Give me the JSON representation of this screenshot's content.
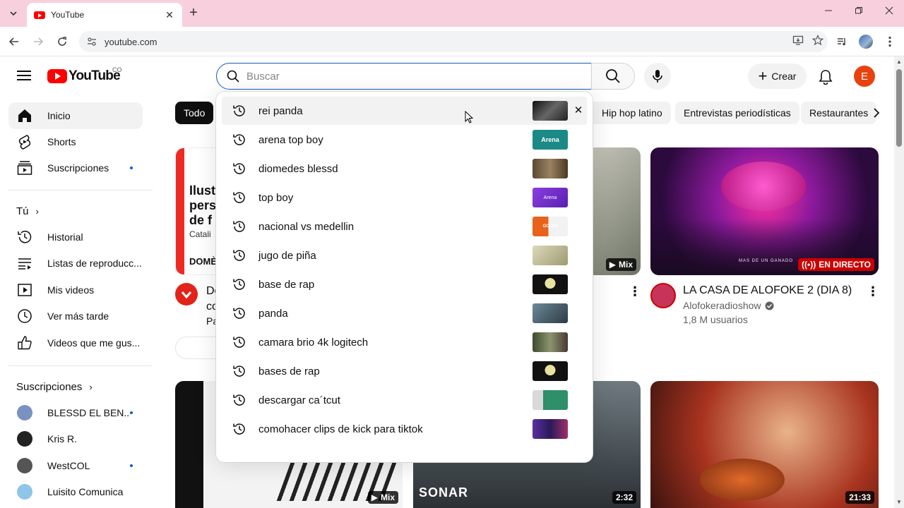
{
  "browser": {
    "tab_title": "YouTube",
    "url": "youtube.com",
    "tab_close": "✕",
    "new_tab": "+"
  },
  "masthead": {
    "logo_text": "YouTube",
    "country_code": "CO",
    "search_placeholder": "Buscar",
    "search_value": "",
    "create_label": "Crear",
    "avatar_letter": "E"
  },
  "sidebar": {
    "main": [
      {
        "label": "Inicio",
        "icon": "home-icon"
      },
      {
        "label": "Shorts",
        "icon": "shorts-icon"
      },
      {
        "label": "Suscripciones",
        "icon": "subscriptions-icon"
      }
    ],
    "you_heading": "Tú",
    "you_items": [
      {
        "label": "Historial",
        "icon": "history-icon"
      },
      {
        "label": "Listas de reproducc...",
        "icon": "playlists-icon"
      },
      {
        "label": "Mis videos",
        "icon": "your-videos-icon"
      },
      {
        "label": "Ver más tarde",
        "icon": "watch-later-icon"
      },
      {
        "label": "Videos que me gus...",
        "icon": "liked-videos-icon"
      }
    ],
    "subs_heading": "Suscripciones",
    "subscriptions": [
      {
        "label": "BLESSD EL BEN...",
        "color": "#7a92c2"
      },
      {
        "label": "Kris R.",
        "color": "#222222"
      },
      {
        "label": "WestCOL",
        "color": "#555555"
      },
      {
        "label": "Luisito Comunica",
        "color": "#8ec5e8"
      }
    ]
  },
  "chips": {
    "selected": "Todo",
    "items": [
      "Hip hop latino",
      "Entrevistas periodísticas",
      "Restaurantes"
    ]
  },
  "videos": {
    "left_partial": {
      "thumb_text": [
        "Ilust",
        "pers",
        "de f",
        "Catali",
        "DOMÈ"
      ],
      "title_fragments": [
        "Do",
        "co",
        "Pa"
      ]
    },
    "mid_thumb_badge": "Mix",
    "live": {
      "title": "LA CASA DE ALOFOKE 2 (DIA 8)",
      "channel": "Alofokeradioshow",
      "meta": "1,8 M usuarios",
      "badge": "EN DIRECTO",
      "thumb_caption": "MAS DE UN GANADO"
    },
    "row2": [
      {
        "badge": "Mix"
      },
      {
        "badge": "2:32",
        "overlay_text": "SONAR"
      },
      {
        "badge": "21:33"
      }
    ]
  },
  "suggestions": [
    {
      "text": "rei panda",
      "thumb": "#2a2a2a",
      "removable": true
    },
    {
      "text": "arena top boy",
      "thumb": "#1b8a86",
      "thumb_text": "Arena"
    },
    {
      "text": "diomedes blessd",
      "thumb": "#6b5a3e"
    },
    {
      "text": "top boy",
      "thumb": "#7c3bd4",
      "thumb_text": "Arena"
    },
    {
      "text": "nacional vs medellin",
      "thumb": "#e9621b",
      "thumb_text": "GOLES"
    },
    {
      "text": "jugo de piña",
      "thumb": "#c9c6a4"
    },
    {
      "text": "base de rap",
      "thumb": "#111111"
    },
    {
      "text": "panda",
      "thumb": "#4a6372"
    },
    {
      "text": "camara brio 4k logitech",
      "thumb": "#5f6b4c"
    },
    {
      "text": "bases de rap",
      "thumb": "#111111"
    },
    {
      "text": "descargar ca´tcut",
      "thumb": "#2f8f6b"
    },
    {
      "text": "comohacer clips de kick para tiktok",
      "thumb": "#4b2f8a"
    }
  ],
  "colors": {
    "brand_red": "#ff0000",
    "tabbar": "#f8cfdc",
    "search_focus": "#1c62b9",
    "avatar": "#e8420f",
    "live_red": "#cc0000"
  }
}
